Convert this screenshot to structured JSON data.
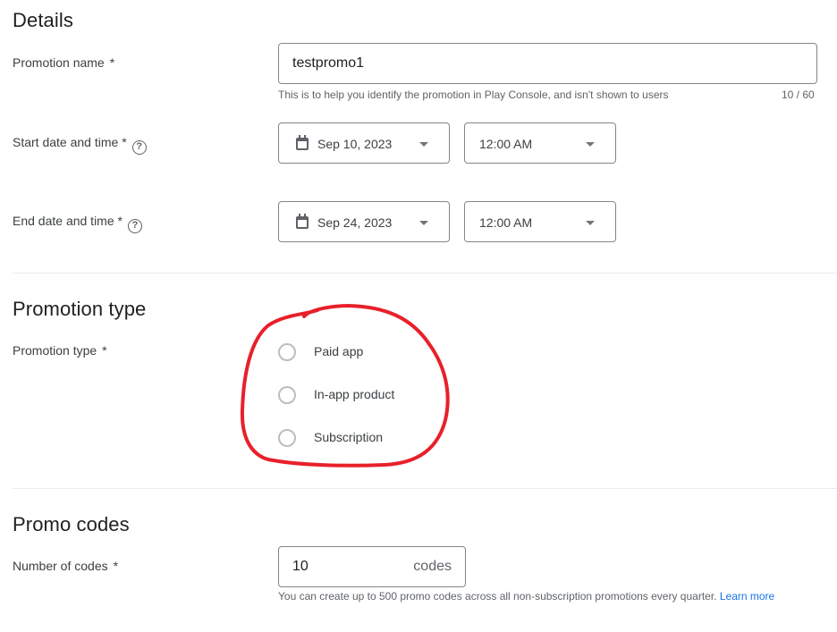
{
  "details": {
    "title": "Details",
    "promotion_name": {
      "label": "Promotion name",
      "required_mark": "*",
      "value": "testpromo1",
      "hint": "This is to help you identify the promotion in Play Console, and isn't shown to users",
      "counter": "10 / 60"
    },
    "start": {
      "label": "Start date and time",
      "required_mark": "*",
      "help_glyph": "?",
      "date": "Sep 10, 2023",
      "time": "12:00 AM"
    },
    "end": {
      "label": "End date and time",
      "required_mark": "*",
      "help_glyph": "?",
      "date": "Sep 24, 2023",
      "time": "12:00 AM"
    }
  },
  "promotion_type": {
    "title": "Promotion type",
    "label": "Promotion type",
    "required_mark": "*",
    "options": [
      {
        "label": "Paid app",
        "selected": false
      },
      {
        "label": "In-app product",
        "selected": false
      },
      {
        "label": "Subscription",
        "selected": false
      }
    ],
    "annotation_color": "#e8202a"
  },
  "promo_codes": {
    "title": "Promo codes",
    "label": "Number of codes",
    "required_mark": "*",
    "value": "10",
    "suffix": "codes",
    "hint": "You can create up to 500 promo codes across all non-subscription promotions every quarter.",
    "learn_more": "Learn more"
  }
}
